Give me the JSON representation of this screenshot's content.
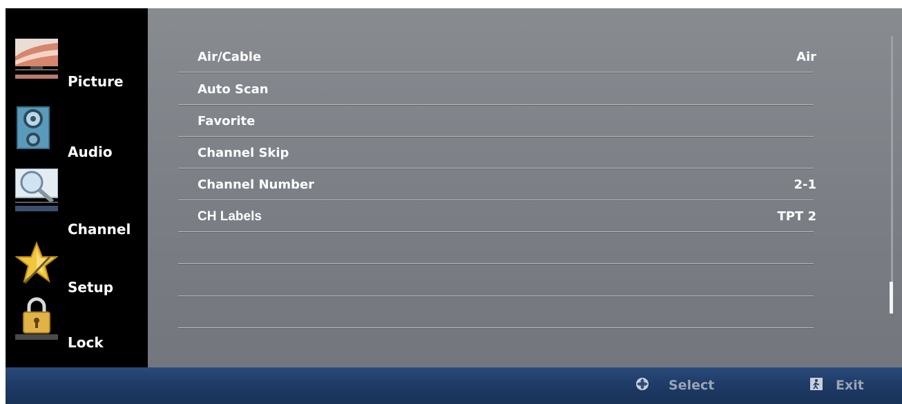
{
  "sidebar": {
    "items": [
      {
        "label": "Picture",
        "icon": "picture-icon"
      },
      {
        "label": "Audio",
        "icon": "speaker-icon"
      },
      {
        "label": "Channel",
        "icon": "magnifier-icon"
      },
      {
        "label": "Setup",
        "icon": "star-icon"
      },
      {
        "label": "Lock",
        "icon": "padlock-icon"
      }
    ],
    "selected": "Channel"
  },
  "menu": {
    "rows": [
      {
        "label": "Air/Cable",
        "value": "Air"
      },
      {
        "label": "Auto Scan",
        "value": ""
      },
      {
        "label": "Favorite",
        "value": ""
      },
      {
        "label": "Channel Skip",
        "value": ""
      },
      {
        "label": "Channel Number",
        "value": "2-1"
      },
      {
        "label": "CH Labels",
        "value": "TPT 2"
      },
      {
        "label": "",
        "value": ""
      },
      {
        "label": "",
        "value": ""
      },
      {
        "label": "",
        "value": ""
      }
    ]
  },
  "footer": {
    "select_label": "Select",
    "select_icon": "dpad-icon",
    "exit_label": "Exit",
    "exit_icon": "exit-icon"
  },
  "colors": {
    "sidebar_bg": "#000000",
    "menu_bg": "#7c8086",
    "footer_bg": "#1e3a66",
    "text": "#ffffff",
    "footer_text": "#9aa4b4"
  }
}
